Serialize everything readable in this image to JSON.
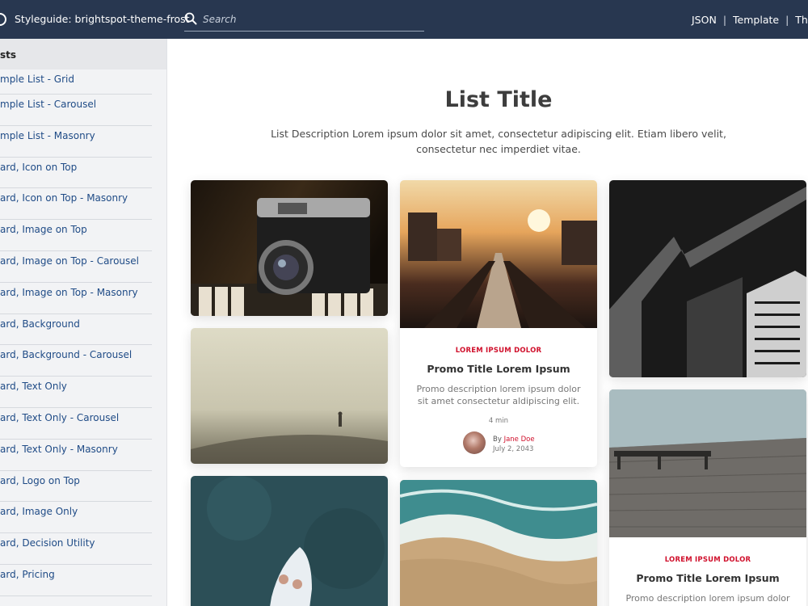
{
  "header": {
    "brand": "Styleguide: brightspot-theme-frost",
    "search_placeholder": "Search",
    "links": [
      "JSON",
      "Template",
      "Them"
    ],
    "background_color": "#283750"
  },
  "sidebar": {
    "section_title": "sts",
    "items": [
      "mple List - Grid",
      "mple List - Carousel",
      "mple List - Masonry",
      "ard, Icon on Top",
      "ard, Icon on Top - Masonry",
      "ard, Image on Top",
      "ard, Image on Top - Carousel",
      "ard, Image on Top - Masonry",
      "ard, Background",
      "ard, Background - Carousel",
      "ard, Text Only",
      "ard, Text Only - Carousel",
      "ard, Text Only - Masonry",
      "ard, Logo on Top",
      "ard, Image Only",
      "ard, Decision Utility",
      "ard, Pricing"
    ]
  },
  "main": {
    "title": "List Title",
    "description": "List Description Lorem ipsum dolor sit amet, consectetur adipiscing elit. Etiam libero velit, consectetur nec imperdiet vitae.",
    "promo_1": {
      "eyebrow": "LOREM IPSUM DOLOR",
      "title": "Promo Title Lorem Ipsum",
      "description": "Promo description lorem ipsum dolor sit amet consectetur aldipiscing elit.",
      "read_time": "4 min",
      "by": "By",
      "author": "Jane Doe",
      "date": "July 2, 2043"
    },
    "promo_2": {
      "eyebrow": "LOREM IPSUM DOLOR",
      "title": "Promo Title Lorem Ipsum",
      "description": "Promo description lorem ipsum dolor sit"
    },
    "accent_color": "#d0102c"
  }
}
